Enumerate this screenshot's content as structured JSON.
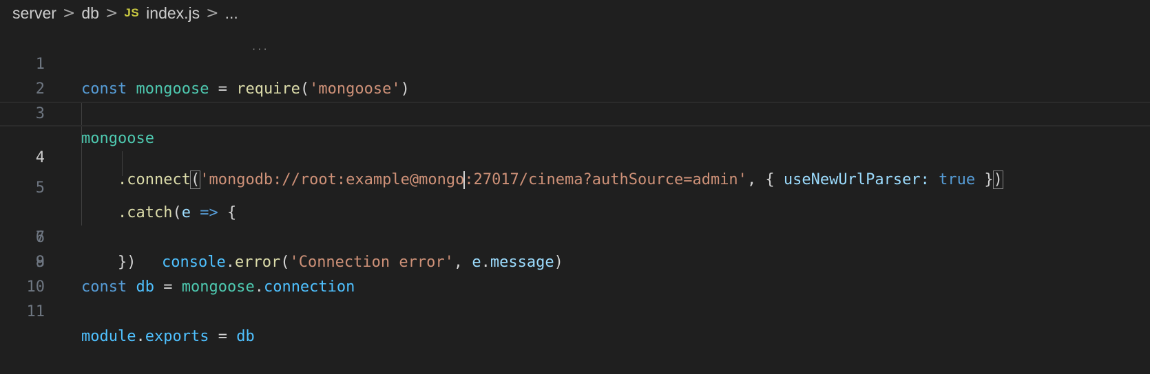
{
  "breadcrumb": {
    "items": [
      "server",
      "db",
      "index.js",
      "..."
    ],
    "separator": ">",
    "file_icon": "JS"
  },
  "colors": {
    "background": "#1f1f1f",
    "keyword": "#569cd6",
    "variable": "#4fc1ff",
    "object": "#4ec9b0",
    "function": "#dcdcaa",
    "string": "#ce9178",
    "property": "#9cdcfe",
    "line_number": "#6e7681"
  },
  "editor": {
    "current_line": 4,
    "line_numbers": [
      "1",
      "2",
      "3",
      "4",
      "5",
      "6",
      "7",
      "8",
      "9",
      "10",
      "11"
    ],
    "lines": {
      "l1": {
        "const": "const",
        "name": "mongoose",
        "eq": " = ",
        "require": "require",
        "open": "(",
        "arg": "'mongoose'",
        "close": ")"
      },
      "l3": {
        "name": "mongoose"
      },
      "l4": {
        "method": ".connect",
        "open": "(",
        "url_a": "'mongodb://root:example@mongo",
        "url_b": ":27017/cinema?authSource=admin'",
        "comma": ", { ",
        "opt": "useNewUrlParser:",
        "space": " ",
        "val": "true",
        "brace": " }",
        "close": ")"
      },
      "l5": {
        "method": ".catch",
        "open": "(",
        "param": "e",
        "arrow": " => ",
        "brace": "{"
      },
      "l6": {
        "obj": "console",
        "dot": ".",
        "fn": "error",
        "open": "(",
        "str": "'Connection error'",
        "comma": ", ",
        "e": "e",
        "dot2": ".",
        "prop": "message",
        "close": ")"
      },
      "l7": {
        "close": "})"
      },
      "l9": {
        "const": "const",
        "name": "db",
        "eq": " = ",
        "obj": "mongoose",
        "dot": ".",
        "prop": "connection"
      },
      "l11": {
        "module": "module",
        "dot": ".",
        "exports": "exports",
        "eq": " = ",
        "db": "db"
      }
    }
  }
}
